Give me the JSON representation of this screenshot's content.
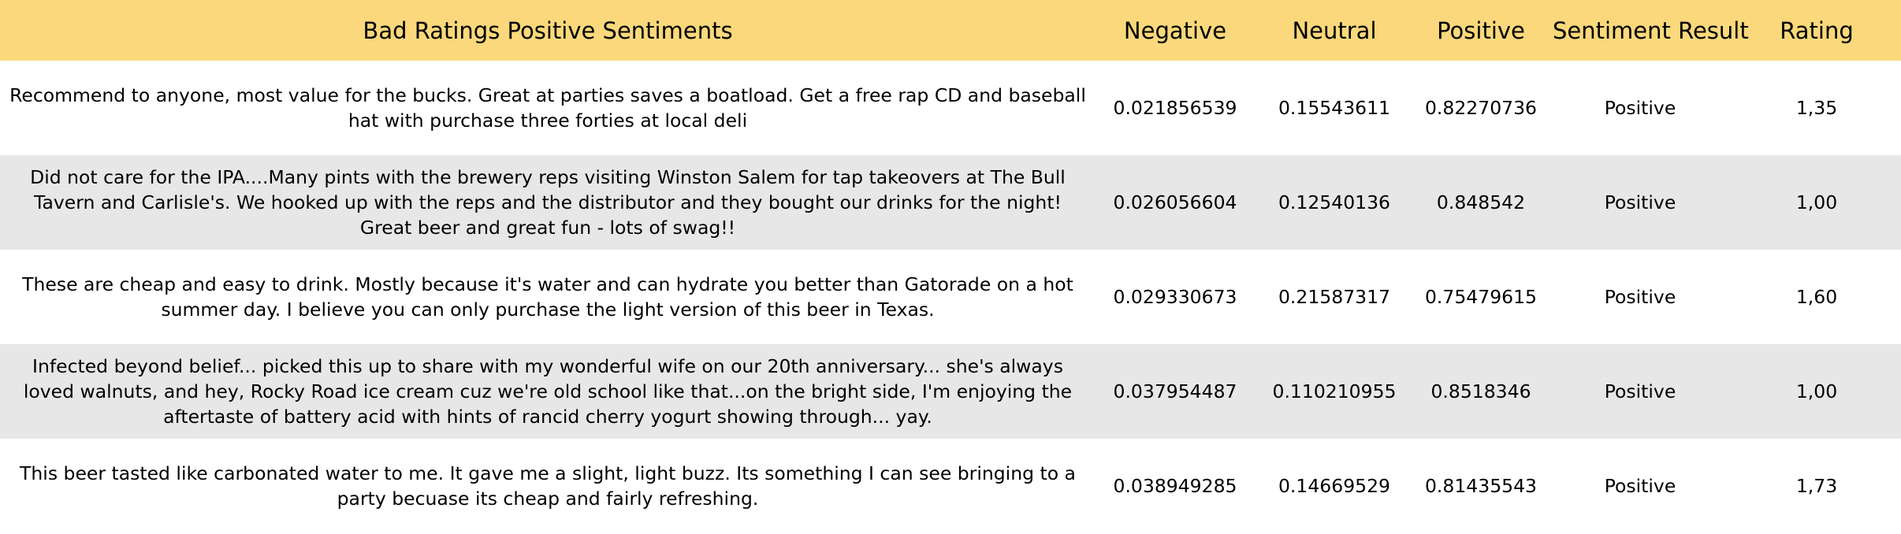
{
  "table": {
    "headers": {
      "review": "Bad Ratings Positive Sentiments",
      "negative": "Negative",
      "neutral": "Neutral",
      "positive": "Positive",
      "sentiment_result": "Sentiment Result",
      "rating": "Rating"
    },
    "rows": [
      {
        "review": "Recommend to anyone, most value for the bucks.  Great at parties saves a boatload.  Get a free rap CD and baseball hat with purchase three forties at local deli",
        "negative": "0.021856539",
        "neutral": "0.15543611",
        "positive": "0.82270736",
        "sentiment_result": "Positive",
        "rating": "1,35"
      },
      {
        "review": "Did not care for the IPA....Many pints with the brewery reps visiting Winston Salem for tap takeovers at The Bull Tavern and Carlisle's. We hooked up with the reps and the distributor and they bought our drinks for the night! Great beer and great fun - lots of swag!!",
        "negative": "0.026056604",
        "neutral": "0.12540136",
        "positive": "0.848542",
        "sentiment_result": "Positive",
        "rating": "1,00"
      },
      {
        "review": "These are cheap and easy to drink. Mostly because it's water and can hydrate you better than Gatorade on a hot summer day. I believe you can only purchase the light version of this beer in Texas.",
        "negative": "0.029330673",
        "neutral": "0.21587317",
        "positive": "0.75479615",
        "sentiment_result": "Positive",
        "rating": "1,60"
      },
      {
        "review": "Infected beyond belief... picked this up to share with my wonderful wife on our 20th anniversary... she's always loved walnuts, and hey, Rocky Road ice cream cuz we're old school like that...on the bright side, I'm enjoying the aftertaste of battery acid with hints of rancid cherry yogurt showing through... yay.",
        "negative": "0.037954487",
        "neutral": "0.110210955",
        "positive": "0.8518346",
        "sentiment_result": "Positive",
        "rating": "1,00"
      },
      {
        "review": "This beer tasted like carbonated water to me. It gave me a slight, light buzz. Its something I can see bringing to a party becuase its cheap and fairly refreshing.",
        "negative": "0.038949285",
        "neutral": "0.14669529",
        "positive": "0.81435543",
        "sentiment_result": "Positive",
        "rating": "1,73"
      }
    ]
  },
  "colors": {
    "header_background": "#fad87b",
    "row_even_background": "#ffffff",
    "row_odd_background": "#e7e7e7",
    "text": "#000000"
  }
}
